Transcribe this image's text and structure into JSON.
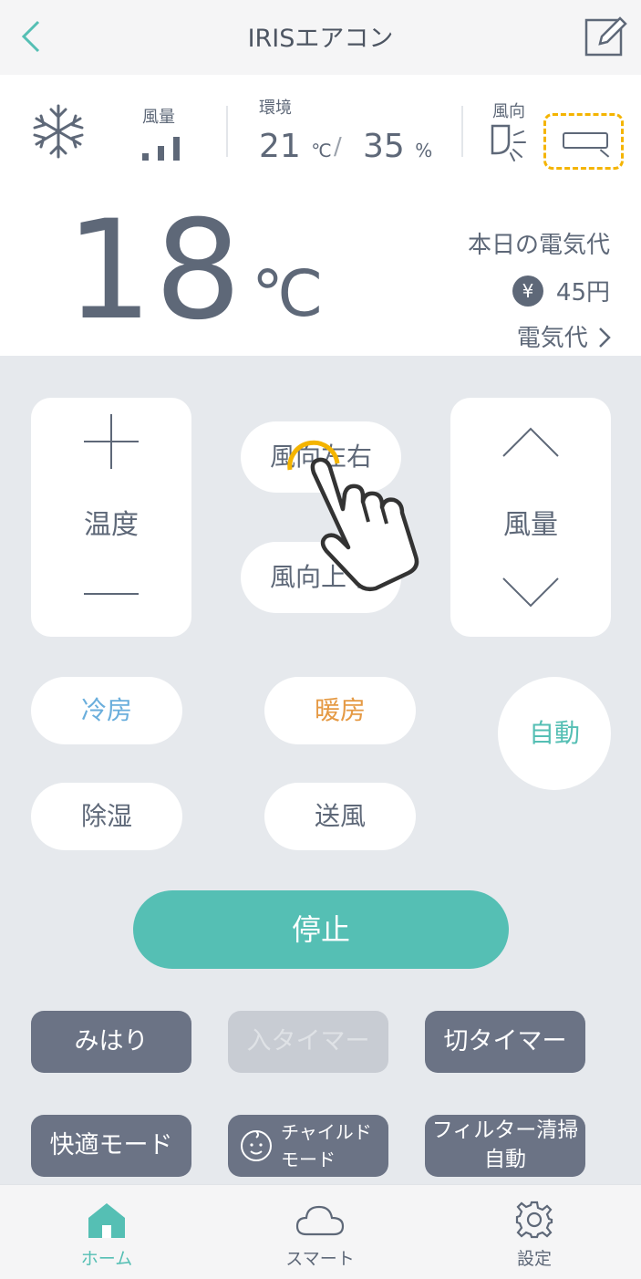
{
  "header": {
    "title": "IRISエアコン"
  },
  "status": {
    "fan_label": "風量",
    "env_label": "環境",
    "env_temp": "21",
    "env_temp_unit": "℃",
    "env_slash": "/",
    "env_humidity": "35",
    "env_humidity_unit": "%",
    "direction_label": "風向",
    "fan_level": 0.66
  },
  "main": {
    "set_temp": "18",
    "set_temp_unit": "℃",
    "cost_title": "本日の電気代",
    "yen_symbol": "¥",
    "cost_value": "45円",
    "cost_link": "電気代"
  },
  "controls": {
    "temp_label": "温度",
    "fan_label": "風量",
    "dir_lr": "風向左右",
    "dir_ud": "風向上下",
    "modes": {
      "cool": "冷房",
      "heat": "暖房",
      "auto": "自動",
      "dry": "除湿",
      "fan": "送風"
    },
    "stop": "停止",
    "watch": "みはり",
    "on_timer": "入タイマー",
    "off_timer": "切タイマー",
    "comfort": "快適モード",
    "child_line1": "チャイルド",
    "child_line2": "モード",
    "filter_line1": "フィルター清掃",
    "filter_line2": "自動"
  },
  "nav": {
    "home": "ホーム",
    "smart": "スマート",
    "settings": "設定"
  },
  "colors": {
    "accent": "#55bfb4",
    "cool": "#6aaedc",
    "heat": "#e59a45",
    "highlight": "#f4b400"
  }
}
